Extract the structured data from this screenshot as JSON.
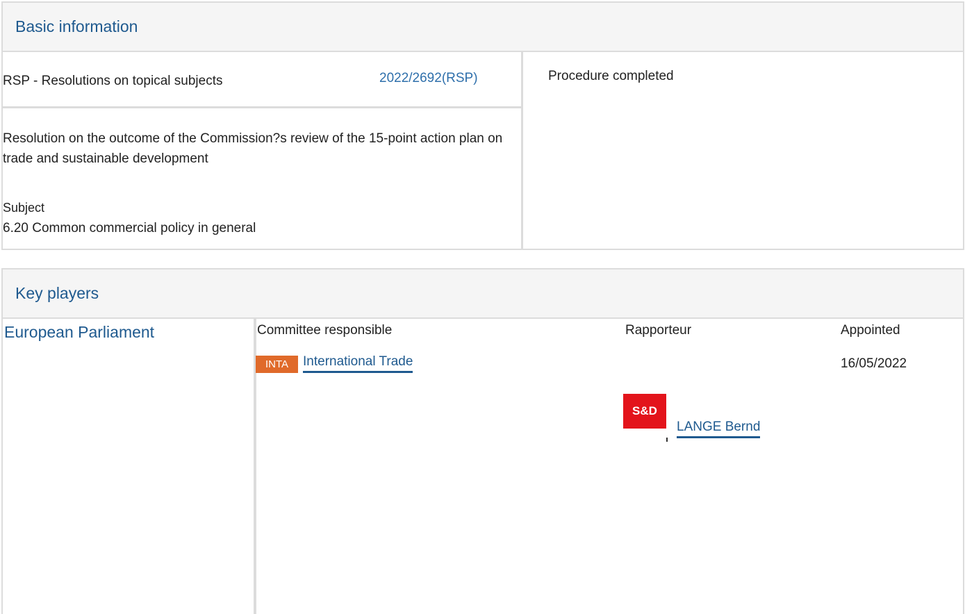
{
  "basic_information": {
    "title": "Basic information",
    "procedure_type": "RSP - Resolutions on topical subjects",
    "reference": "2022/2692(RSP)",
    "status": "Procedure completed",
    "procedure_title": "Resolution on the outcome of the Commission?s review of the 15-point action plan on trade and sustainable development",
    "subject_label": "Subject",
    "subject_value": "6.20 Common commercial policy in general"
  },
  "key_players": {
    "title": "Key players",
    "institution": "European Parliament",
    "headers": {
      "committee": "Committee responsible",
      "rapporteur": "Rapporteur",
      "appointed": "Appointed"
    },
    "committee": {
      "code": "INTA",
      "name": "International Trade",
      "badge_color": "#e06a2a"
    },
    "appointed_date": "16/05/2022",
    "rapporteur": {
      "party_logo_text": "S&D",
      "party_color": "#e3141b",
      "name": "LANGE Bernd"
    }
  },
  "colors": {
    "heading": "#1f5a8f",
    "link": "#2e6fab",
    "border": "#dcdcdc",
    "header_bg": "#f5f5f5"
  }
}
